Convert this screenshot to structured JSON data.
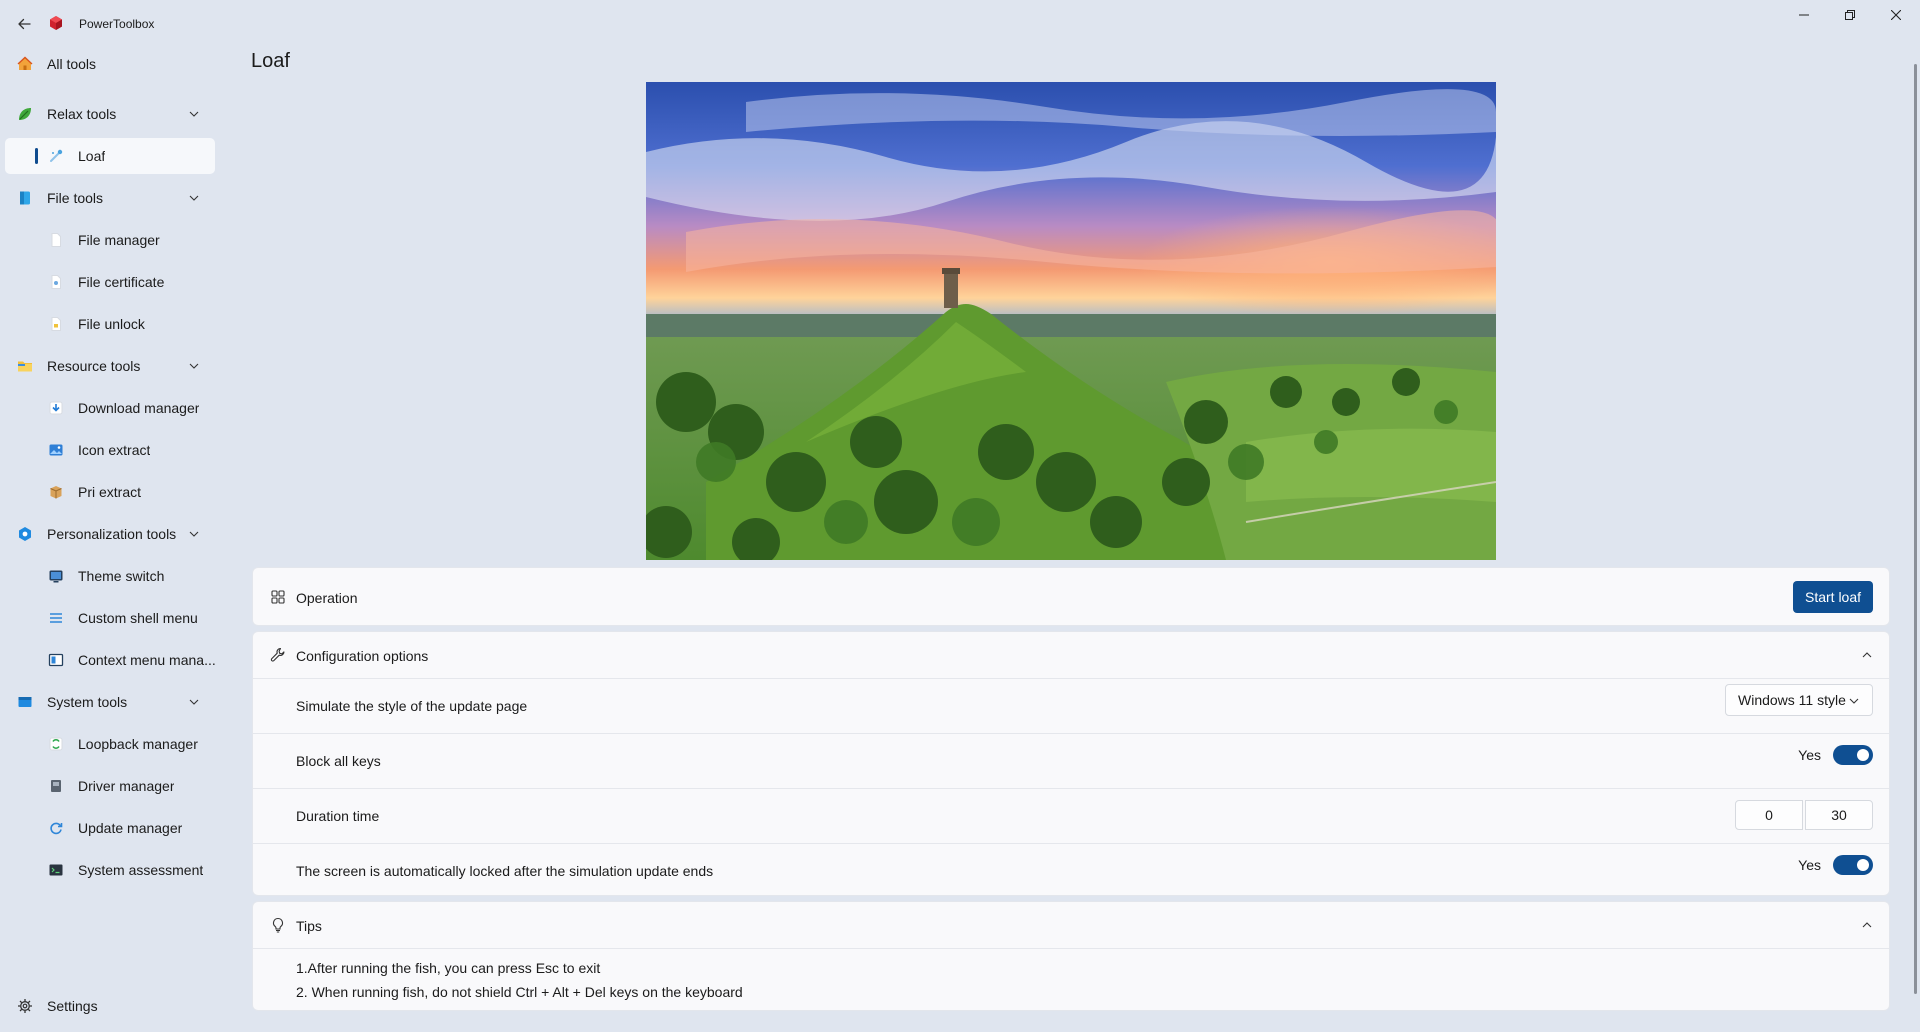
{
  "app": {
    "title": "PowerToolbox"
  },
  "sidebar": {
    "all_tools": "All tools",
    "groups": [
      {
        "label": "Relax tools",
        "items": [
          {
            "label": "Loaf",
            "selected": true
          }
        ]
      },
      {
        "label": "File tools",
        "items": [
          {
            "label": "File manager"
          },
          {
            "label": "File certificate"
          },
          {
            "label": "File unlock"
          }
        ]
      },
      {
        "label": "Resource tools",
        "items": [
          {
            "label": "Download manager"
          },
          {
            "label": "Icon extract"
          },
          {
            "label": "Pri extract"
          }
        ]
      },
      {
        "label": "Personalization tools",
        "items": [
          {
            "label": "Theme switch"
          },
          {
            "label": "Custom shell menu"
          },
          {
            "label": "Context menu mana..."
          }
        ]
      },
      {
        "label": "System tools",
        "items": [
          {
            "label": "Loopback manager"
          },
          {
            "label": "Driver manager"
          },
          {
            "label": "Update manager"
          },
          {
            "label": "System assessment"
          }
        ]
      }
    ],
    "settings": "Settings"
  },
  "page": {
    "title": "Loaf"
  },
  "operation": {
    "label": "Operation",
    "button": "Start loaf"
  },
  "config": {
    "label": "Configuration options",
    "style_label": "Simulate the style of the update page",
    "style_value": "Windows 11 style",
    "block_keys_label": "Block all keys",
    "block_keys_state": "Yes",
    "duration_label": "Duration time",
    "duration_hours": "0",
    "duration_minutes": "30",
    "lock_label": "The screen is automatically locked after the simulation update ends",
    "lock_state": "Yes"
  },
  "tips": {
    "label": "Tips",
    "lines": [
      "1.After running the fish, you can press Esc to exit",
      "2. When running fish, do not shield Ctrl + Alt + Del keys on the keyboard"
    ]
  },
  "colors": {
    "accent": "#0f4f92",
    "background": "#dfe5ef",
    "card": "#f9f9fb"
  }
}
